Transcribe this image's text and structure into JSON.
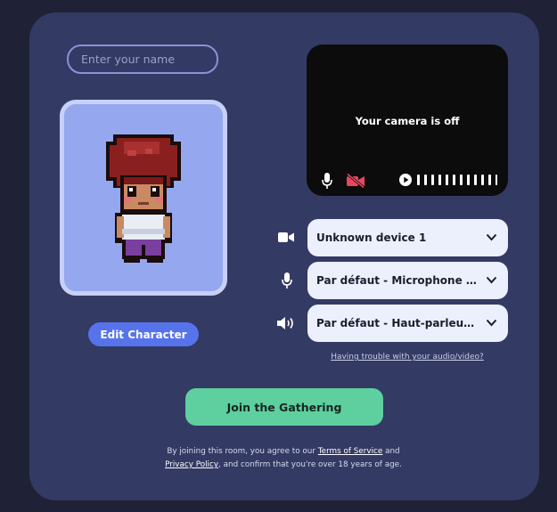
{
  "name_input": {
    "placeholder": "Enter your name",
    "value": ""
  },
  "avatar": {
    "edit_label": "Edit Character"
  },
  "camera": {
    "off_text": "Your camera is off",
    "icons": [
      "microphone-icon",
      "camera-off-icon",
      "play-icon",
      "audio-level-meter"
    ]
  },
  "devices": {
    "camera": {
      "icon": "camera-icon",
      "selected": "Unknown device 1"
    },
    "microphone": {
      "icon": "microphone-icon",
      "selected": "Par défaut - Microphone MacBook Pro"
    },
    "speakers": {
      "icon": "speaker-icon",
      "selected": "Par défaut - Haut-parleurs MacBook Pro"
    }
  },
  "trouble_link": "Having trouble with your audio/video?",
  "join_label": "Join the Gathering",
  "terms": {
    "prefix": "By joining this room, you agree to our",
    "terms_link": "Terms of Service",
    "and": "and",
    "privacy_link": "Privacy Policy",
    "suffix": ", and confirm that you're over 18 years of age."
  },
  "colors": {
    "background": "#1f2236",
    "card": "#333a64",
    "accent": "#5773ec",
    "join": "#5ecf9e",
    "camera_off": "#e8475f"
  }
}
